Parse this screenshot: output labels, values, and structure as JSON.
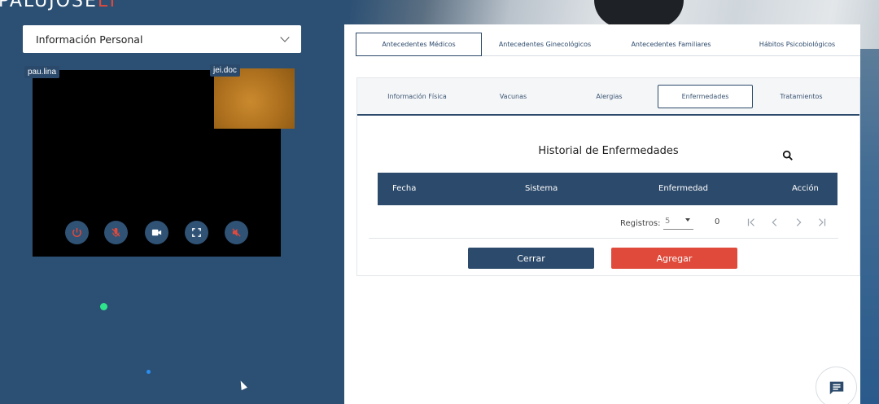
{
  "logo": {
    "text": "PALUJOSE",
    "accent": "LY"
  },
  "info_select": {
    "label": "Información Personal"
  },
  "video": {
    "remote_label": "pau.lina",
    "local_label": "jei.doc",
    "controls": [
      "power-icon",
      "mic-off-icon",
      "camera-icon",
      "fullscreen-icon",
      "volume-off-icon"
    ]
  },
  "top_tabs": [
    {
      "label": "Antecedentes Médicos",
      "active": true
    },
    {
      "label": "Antecedentes Ginecológicos",
      "active": false
    },
    {
      "label": "Antecedentes Familiares",
      "active": false
    },
    {
      "label": "Hábitos Psicobiológicos",
      "active": false
    }
  ],
  "sub_tabs": [
    {
      "label": "Información Física",
      "active": false
    },
    {
      "label": "Vacunas",
      "active": false
    },
    {
      "label": "Alergias",
      "active": false
    },
    {
      "label": "Enfermedades",
      "active": true
    },
    {
      "label": "Tratamientos",
      "active": false
    }
  ],
  "history": {
    "title": "Historial de Enfermedades",
    "columns": [
      "Fecha",
      "Sistema",
      "Enfermedad",
      "Acción"
    ]
  },
  "pager": {
    "label": "Registros:",
    "page_size": "5",
    "count": "0"
  },
  "buttons": {
    "close": "Cerrar",
    "add": "Agregar"
  },
  "colors": {
    "primary": "#2c4a6b",
    "danger": "#df4a3b",
    "background": "#2c5074"
  }
}
